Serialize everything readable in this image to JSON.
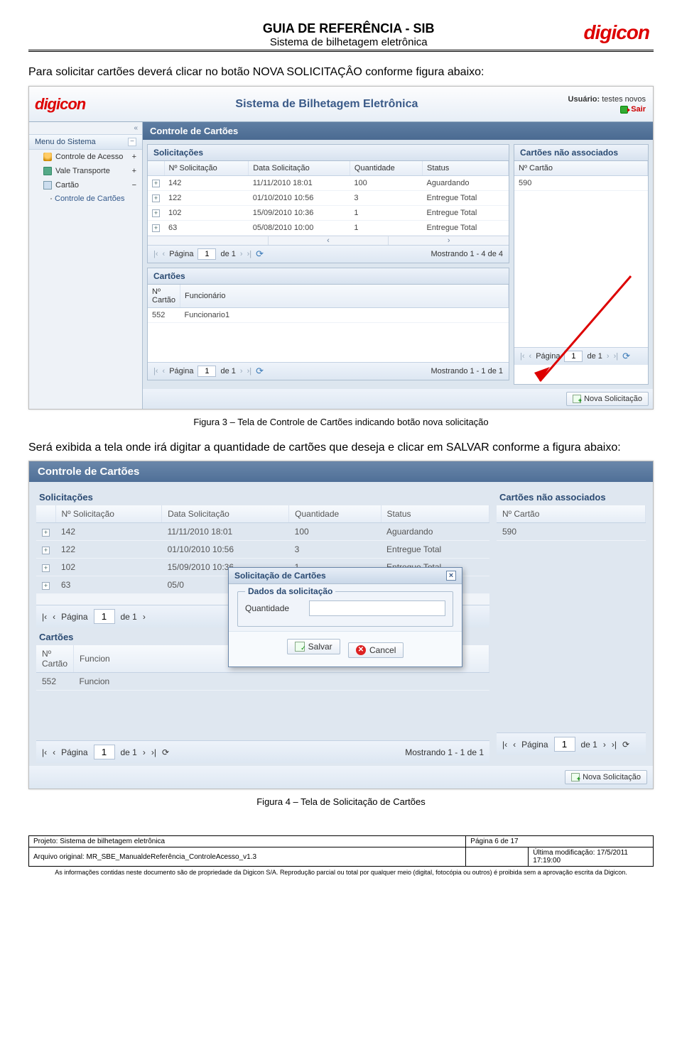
{
  "doc": {
    "title": "GUIA DE REFERÊNCIA - SIB",
    "subtitle": "Sistema de bilhetagem eletrônica",
    "brand": "digicon"
  },
  "paragraphs": {
    "p1": "Para solicitar cartões deverá clicar no botão NOVA SOLICITAÇÂO conforme figura abaixo:",
    "caption1": "Figura  3 – Tela de Controle de Cartões indicando botão nova solicitação",
    "p2": "Será exibida a tela onde irá digitar a quantidade de cartões que deseja e clicar em SALVAR conforme a figura abaixo:",
    "caption2": "Figura  4 – Tela de Solicitação de Cartões"
  },
  "app1": {
    "title": "Sistema de Bilhetagem Eletrônica",
    "userLabel": "Usuário:",
    "userName": "testes novos",
    "logout": "Sair",
    "menuHeader": "Menu do Sistema",
    "menu": {
      "acesso": "Controle de Acesso",
      "vale": "Vale Transporte",
      "cartao": "Cartão",
      "sub_cartoes": "Controle de Cartões"
    },
    "panelTitle": "Controle de Cartões",
    "grids": {
      "solicitacoesTitle": "Solicitações",
      "cartoesTitle": "Cartões",
      "naoAssocTitle": "Cartões não associados"
    },
    "solHeaders": {
      "n": "Nº Solicitação",
      "data": "Data Solicitação",
      "qtd": "Quantidade",
      "status": "Status"
    },
    "solRows": [
      {
        "n": "142",
        "data": "11/11/2010 18:01",
        "qtd": "100",
        "status": "Aguardando"
      },
      {
        "n": "122",
        "data": "01/10/2010 10:56",
        "qtd": "3",
        "status": "Entregue Total"
      },
      {
        "n": "102",
        "data": "15/09/2010 10:36",
        "qtd": "1",
        "status": "Entregue Total"
      },
      {
        "n": "63",
        "data": "05/08/2010 10:00",
        "qtd": "1",
        "status": "Entregue Total"
      }
    ],
    "pager": {
      "labelPagina": "Página",
      "pageValue": "1",
      "ofLabel": "de 1",
      "showing14": "Mostrando 1 - 4 de 4",
      "showing11": "Mostrando 1 - 1 de 1"
    },
    "cartHeaders": {
      "n": "Nº Cartão",
      "func": "Funcionário"
    },
    "cartRows": [
      {
        "n": "552",
        "func": "Funcionario1"
      }
    ],
    "naHeaders": {
      "n": "Nº Cartão"
    },
    "naRows": [
      {
        "n": "590"
      }
    ],
    "naPager": {
      "labelPagina": "Página",
      "pageValue": "1",
      "ofLabel": "de 1"
    },
    "novaBtn": "Nova Solicitação"
  },
  "app2": {
    "panelTitle": "Controle de Cartões",
    "solicitacoesTitle": "Solicitações",
    "naoAssocTitle": "Cartões não associados",
    "cartoesTitle": "Cartões",
    "solHeaders": {
      "n": "Nº Solicitação",
      "data": "Data Solicitação",
      "qtd": "Quantidade",
      "status": "Status"
    },
    "solRows": [
      {
        "n": "142",
        "data": "11/11/2010 18:01",
        "qtd": "100",
        "status": "Aguardando"
      },
      {
        "n": "122",
        "data": "01/10/2010 10:56",
        "qtd": "3",
        "status": "Entregue Total"
      },
      {
        "n": "102",
        "data": "15/09/2010 10:36",
        "qtd": "1",
        "status": "Entregue Total"
      },
      {
        "n": "63",
        "data": "05/0",
        "qtd": "",
        "status": ""
      }
    ],
    "pager": {
      "labelPagina": "Página",
      "pageValue": "1",
      "ofLabel": "de 1",
      "showing11": "Mostrando 1 - 1 de 1"
    },
    "cartHeaders": {
      "n": "Nº Cartão",
      "func": "Funcion"
    },
    "cartRows": [
      {
        "n": "552",
        "func": "Funcion"
      }
    ],
    "naHeaders": {
      "n": "Nº Cartão"
    },
    "naRows": [
      {
        "n": "590"
      }
    ],
    "naPager": {
      "labelPagina": "Página",
      "pageValue": "1",
      "ofLabel": "de 1"
    },
    "modal": {
      "title": "Solicitação de Cartões",
      "legend": "Dados da solicitação",
      "fieldLabel": "Quantidade",
      "save": "Salvar",
      "cancel": "Cancel"
    },
    "novaBtn": "Nova Solicitação"
  },
  "footer": {
    "projetoLabel": "Projeto:",
    "projetoValue": "Sistema de bilhetagem eletrônica",
    "pagina": "Página 6 de 17",
    "arquivoLabel": "Arquivo original:",
    "arquivoValue": "MR_SBE_ManualdeReferência_ControleAcesso_v1.3",
    "modLabel": "Última modificação:",
    "modValue": "17/5/2011 17:19:00",
    "legal": "As informações contidas neste documento são de propriedade da Digicon S/A. Reprodução parcial ou total por qualquer meio (digital, fotocópia ou outros) é proibida sem a aprovação escrita da Digicon."
  }
}
